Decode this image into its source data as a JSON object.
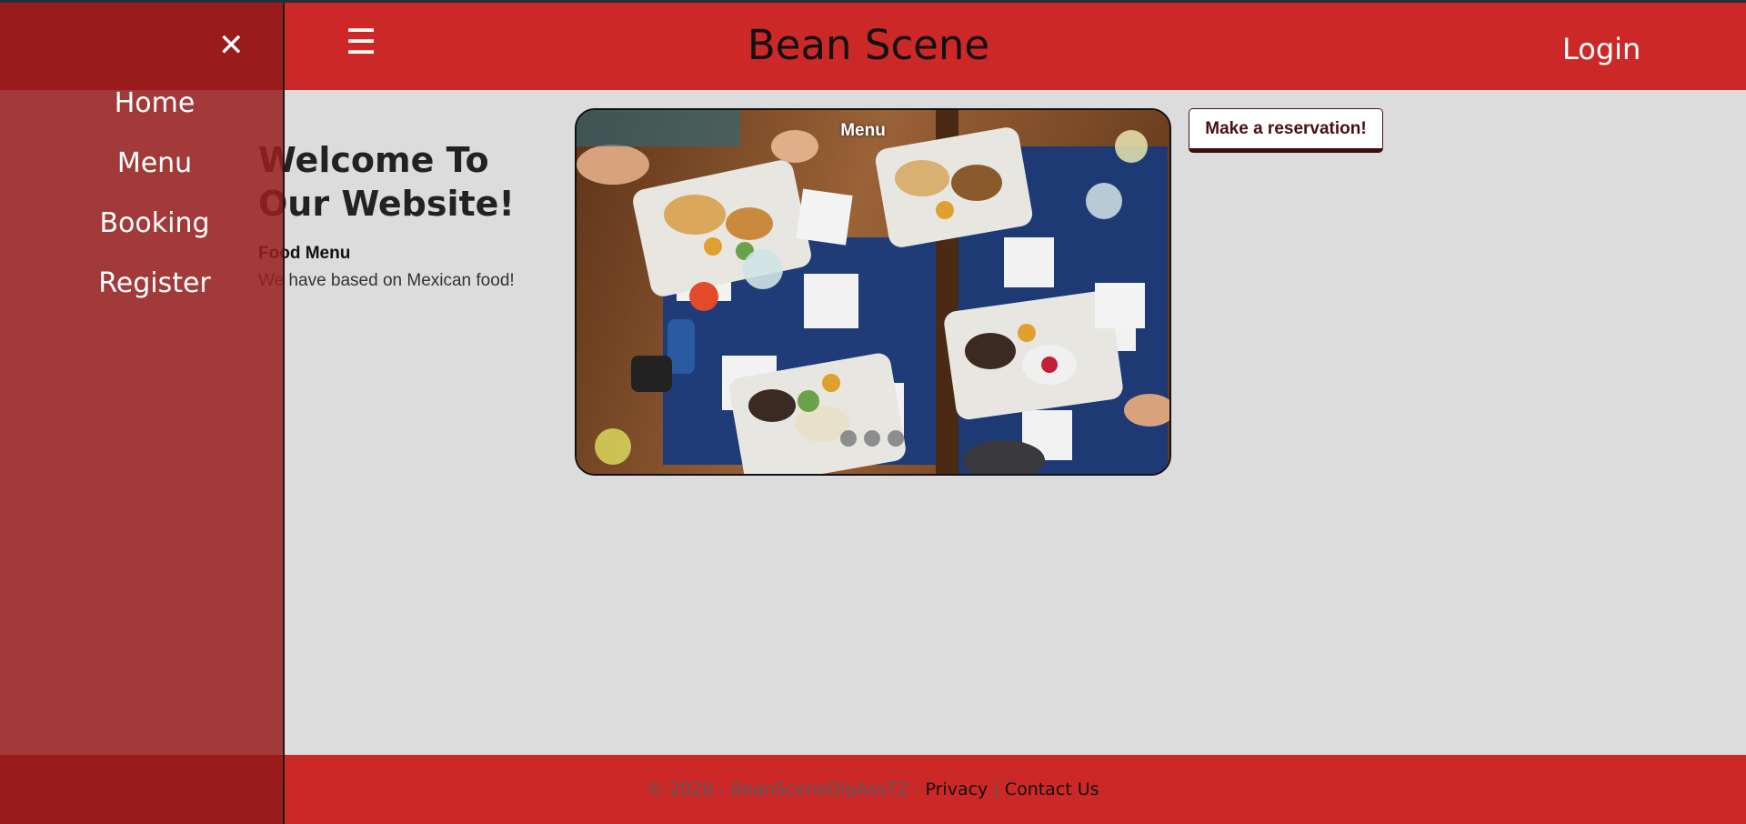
{
  "header": {
    "title": "Bean Scene",
    "login_label": "Login",
    "menu_icon": "hamburger-icon"
  },
  "welcome": {
    "heading": "Welcome To Our Website!",
    "subheading": "Food Menu",
    "description": "We have based on Mexican food!"
  },
  "carousel": {
    "caption": "Menu",
    "slide_count": 3,
    "active_slide": 1
  },
  "reservation": {
    "button_label": "Make a reservation!"
  },
  "sidenav": {
    "close_icon": "close-icon",
    "items": [
      {
        "label": "Home"
      },
      {
        "label": "Menu"
      },
      {
        "label": "Booking"
      },
      {
        "label": "Register"
      }
    ]
  },
  "footer": {
    "copyright": "© 2020 - BeanSceneDipAssT2 -",
    "privacy_label": "Privacy",
    "separator": "|",
    "contact_label": "Contact Us"
  },
  "colors": {
    "brand_red": "#cd2828",
    "sidenav_bg": "#992020",
    "page_bg": "#dcdcdc"
  }
}
